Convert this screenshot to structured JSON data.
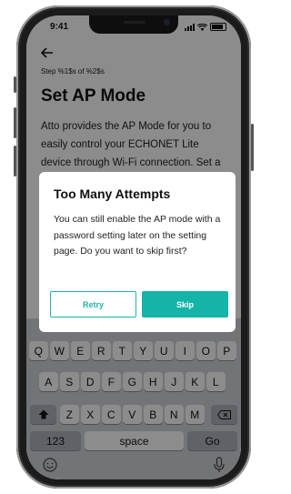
{
  "status": {
    "time": "9:41"
  },
  "page": {
    "back_icon": "arrow-left-icon",
    "step_text": "Step %1$s of %2$s",
    "title": "Set AP Mode",
    "description": "Atto provides the AP Mode for you to easily control your ECHONET Lite device through Wi-Fi connection. Set a"
  },
  "dialog": {
    "title": "Too Many Attempts",
    "message": "You can still enable the AP mode with a password setting later on the setting page. Do you want to skip first?",
    "retry_label": "Retry",
    "skip_label": "Skip"
  },
  "keyboard": {
    "row1": [
      "Q",
      "W",
      "E",
      "R",
      "T",
      "Y",
      "U",
      "I",
      "O",
      "P"
    ],
    "row2": [
      "A",
      "S",
      "D",
      "F",
      "G",
      "H",
      "J",
      "K",
      "L"
    ],
    "row3": [
      "Z",
      "X",
      "C",
      "V",
      "B",
      "N",
      "M"
    ],
    "num_label": "123",
    "space_label": "space",
    "go_label": "Go",
    "shift_icon": "shift-icon",
    "backspace_icon": "backspace-icon",
    "emoji_icon": "emoji-icon",
    "mic_icon": "microphone-icon"
  },
  "colors": {
    "accent": "#14b4a8"
  }
}
